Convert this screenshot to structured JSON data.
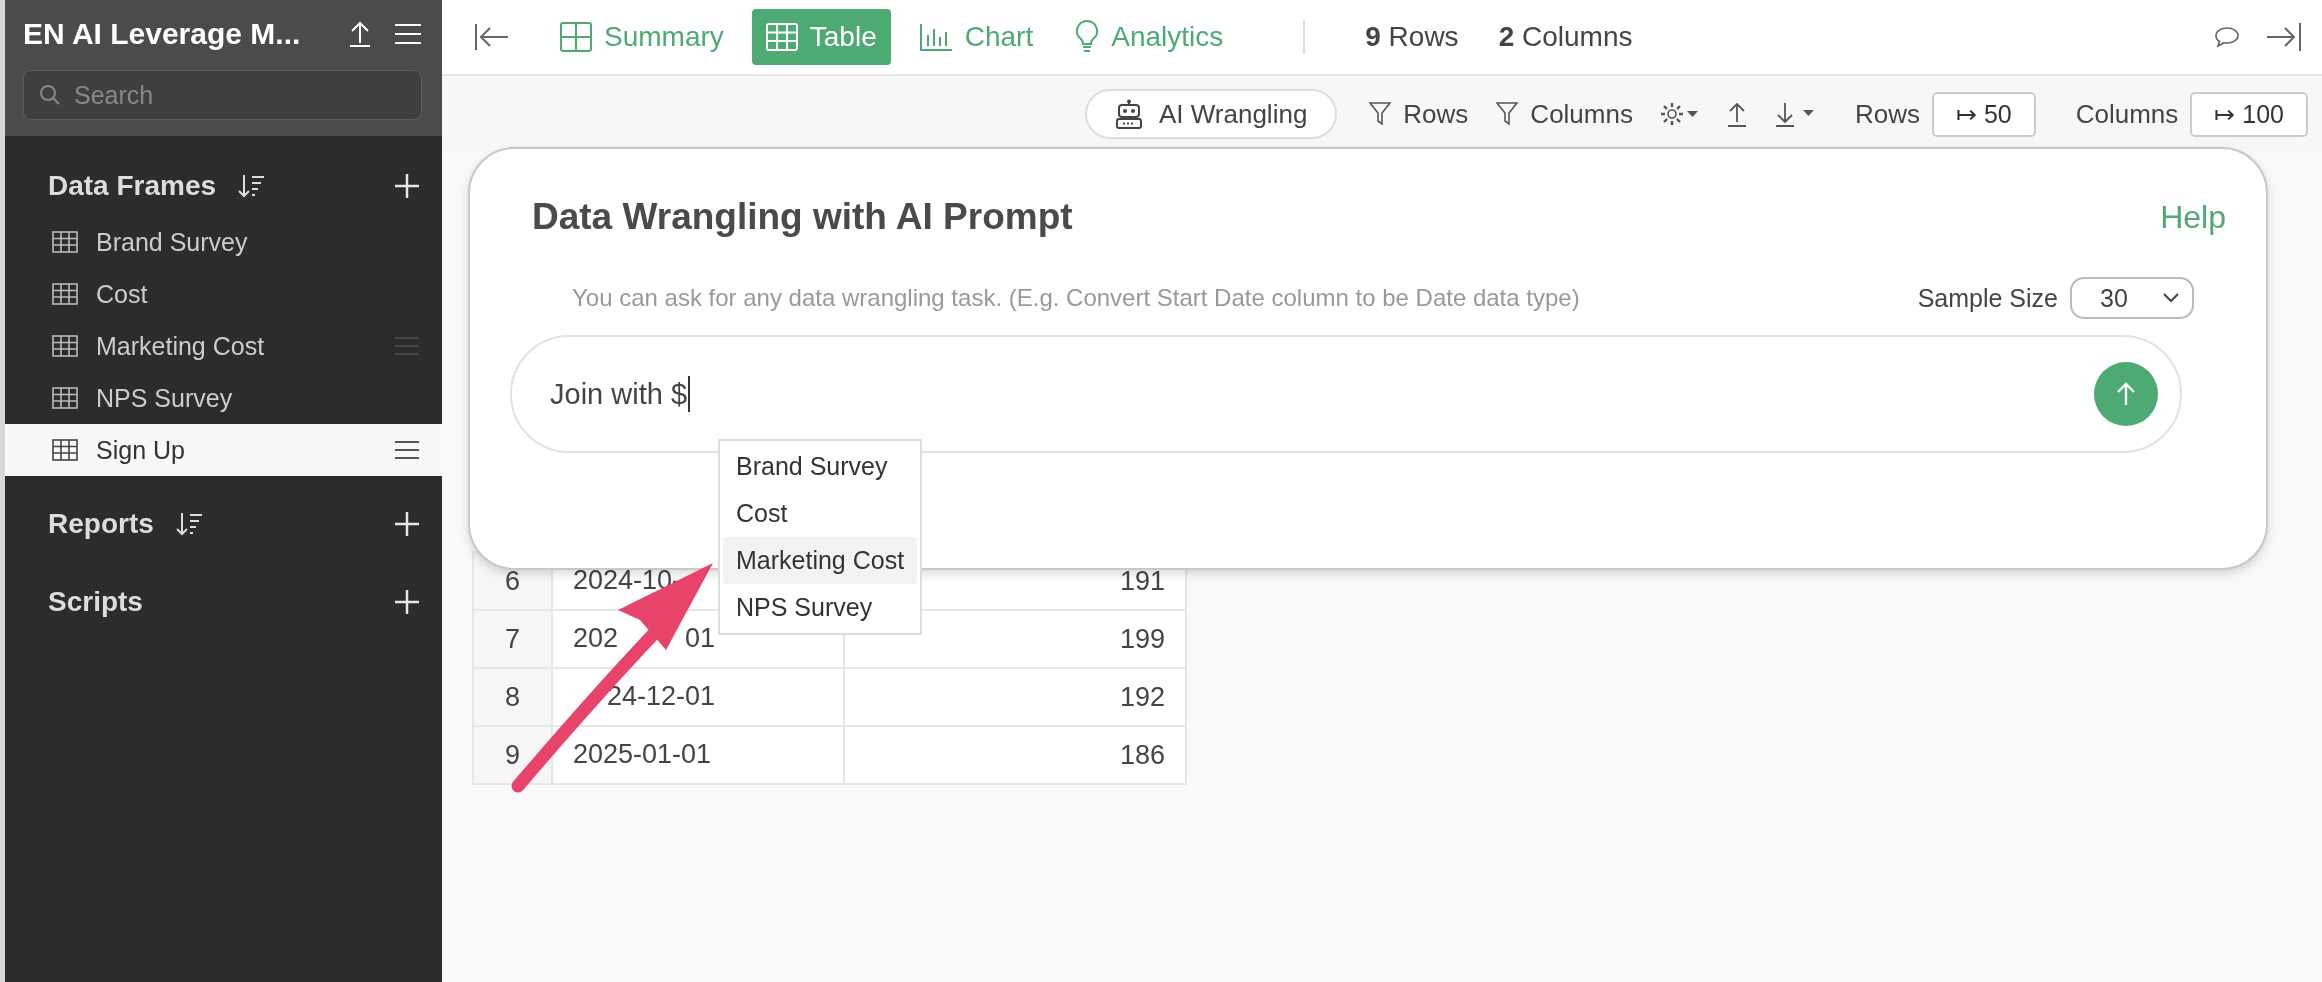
{
  "sidebar": {
    "title": "EN AI Leverage M...",
    "search": {
      "placeholder": "Search"
    },
    "sections": [
      {
        "title": "Data Frames",
        "sortable": true,
        "items": [
          {
            "label": "Brand Survey",
            "selected": false,
            "hovered": false
          },
          {
            "label": "Cost",
            "selected": false,
            "hovered": false
          },
          {
            "label": "Marketing Cost",
            "selected": false,
            "hovered": true
          },
          {
            "label": "NPS Survey",
            "selected": false,
            "hovered": false
          },
          {
            "label": "Sign Up",
            "selected": true,
            "hovered": false
          }
        ]
      },
      {
        "title": "Reports",
        "sortable": true
      },
      {
        "title": "Scripts",
        "sortable": false
      }
    ]
  },
  "tabs": [
    {
      "label": "Summary",
      "kind": "summary",
      "selected": false
    },
    {
      "label": "Table",
      "kind": "table",
      "selected": true
    },
    {
      "label": "Chart",
      "kind": "chart",
      "selected": false
    },
    {
      "label": "Analytics",
      "kind": "analytics",
      "selected": false
    }
  ],
  "counts": [
    {
      "number": "9",
      "label": "Rows"
    },
    {
      "number": "2",
      "label": "Columns"
    }
  ],
  "toolbar": {
    "ai_button": "AI Wrangling",
    "filters": [
      "Rows",
      "Columns"
    ],
    "limits": [
      {
        "label": "Rows",
        "value": "↦ 50"
      },
      {
        "label": "Columns",
        "value": "↦ 100"
      }
    ]
  },
  "table": {
    "rows": [
      {
        "number": "6",
        "date_parts": [
          {
            "text": "2024-10-",
            "kind": "lead"
          }
        ],
        "value": "191"
      },
      {
        "number": "7",
        "date_parts": [
          {
            "text": "202",
            "kind": "lead"
          },
          {
            "text": "01",
            "kind": "tail"
          }
        ],
        "value": "199"
      },
      {
        "number": "8",
        "date_parts": [
          {
            "text": "24-12-01",
            "kind": "tail"
          }
        ],
        "value": "192"
      },
      {
        "number": "9",
        "date_parts": [
          {
            "text": "2025-01-01",
            "kind": "lead"
          }
        ],
        "value": "186"
      }
    ]
  },
  "dialog": {
    "title": "Data Wrangling with AI Prompt",
    "help": "Help",
    "hint": "You can ask for any data wrangling task. (E.g. Convert Start Date column to be Date data type)",
    "sample_size_label": "Sample Size",
    "sample_size": "30",
    "prompt": "Join with $",
    "suggestions": [
      {
        "label": "Brand Survey",
        "selected": false
      },
      {
        "label": "Cost",
        "selected": false
      },
      {
        "label": "Marketing Cost",
        "selected": true
      },
      {
        "label": "NPS Survey",
        "selected": false
      }
    ]
  }
}
